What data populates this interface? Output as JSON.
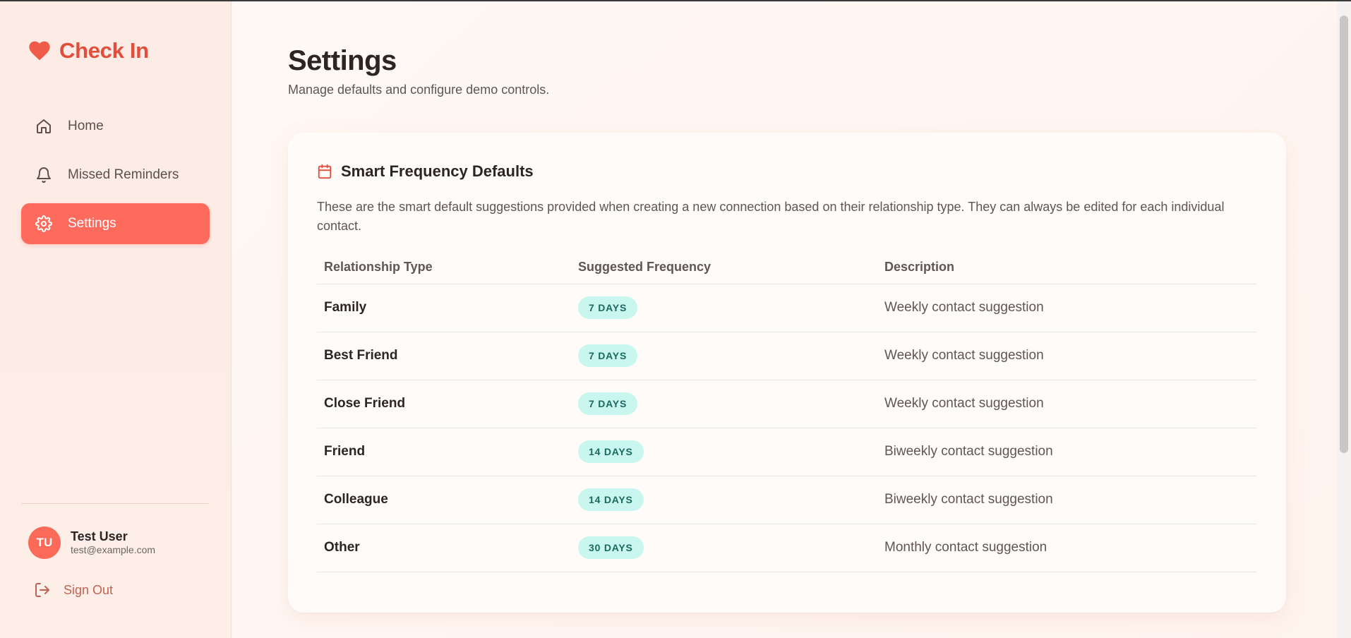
{
  "app": {
    "name": "Check In"
  },
  "sidebar": {
    "items": [
      {
        "label": "Home",
        "icon": "home-icon",
        "active": false
      },
      {
        "label": "Missed Reminders",
        "icon": "bell-icon",
        "active": false
      },
      {
        "label": "Settings",
        "icon": "gear-icon",
        "active": true
      }
    ],
    "user": {
      "initials": "TU",
      "name": "Test User",
      "email": "test@example.com"
    },
    "signout_label": "Sign Out"
  },
  "page": {
    "title": "Settings",
    "subtitle": "Manage defaults and configure demo controls."
  },
  "card": {
    "icon": "calendar-icon",
    "title": "Smart Frequency Defaults",
    "description": "These are the smart default suggestions provided when creating a new connection based on their relationship type. They can always be edited for each individual contact.",
    "table": {
      "headers": [
        "Relationship Type",
        "Suggested Frequency",
        "Description"
      ],
      "rows": [
        {
          "type": "Family",
          "frequency": "7 DAYS",
          "description": "Weekly contact suggestion"
        },
        {
          "type": "Best Friend",
          "frequency": "7 DAYS",
          "description": "Weekly contact suggestion"
        },
        {
          "type": "Close Friend",
          "frequency": "7 DAYS",
          "description": "Weekly contact suggestion"
        },
        {
          "type": "Friend",
          "frequency": "14 DAYS",
          "description": "Biweekly contact suggestion"
        },
        {
          "type": "Colleague",
          "frequency": "14 DAYS",
          "description": "Biweekly contact suggestion"
        },
        {
          "type": "Other",
          "frequency": "30 DAYS",
          "description": "Monthly contact suggestion"
        }
      ]
    }
  },
  "colors": {
    "brand": "#e24e3c",
    "active_nav": "#fe6b5c",
    "badge_bg": "#c9f6ef",
    "badge_text": "#1b6a60"
  }
}
